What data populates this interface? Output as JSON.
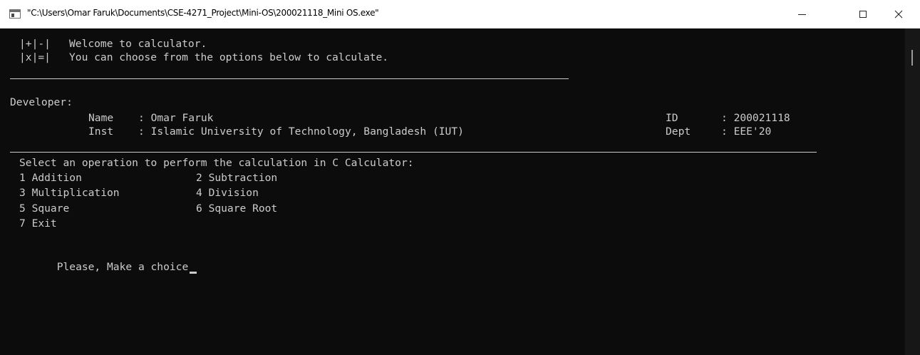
{
  "window": {
    "title": "\"C:\\Users\\Omar Faruk\\Documents\\CSE-4271_Project\\Mini-OS\\200021118_Mini OS.exe\"",
    "controls": {
      "minimize": "—",
      "close": "✕"
    }
  },
  "console": {
    "logo_top": "|+|-|",
    "logo_bottom": "|x|=|",
    "welcome": "Welcome to calculator.",
    "intro": "You can choose from the options below to calculate.",
    "developer_heading": "Developer:",
    "name_label": "Name",
    "name_value": ": Omar Faruk",
    "inst_label": "Inst",
    "inst_value": ": Islamic University of Technology, Bangladesh (IUT)",
    "id_label": "ID",
    "id_value": ": 200021118",
    "dept_label": "Dept",
    "dept_value": ": EEE'20",
    "select_prompt": "Select an operation to perform the calculation in C Calculator:",
    "options": [
      "1 Addition",
      "2 Subtraction",
      "3 Multiplication",
      "4 Division",
      "5 Square",
      "6 Square Root",
      "7 Exit"
    ],
    "choice_prompt": "Please, Make a choice"
  }
}
